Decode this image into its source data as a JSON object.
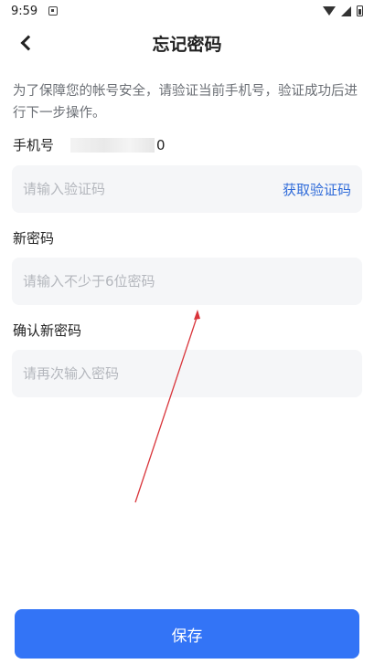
{
  "status_bar": {
    "time": "9:59",
    "notification_icon": "notification-icon",
    "wifi_icon": "wifi-icon",
    "signal_icon": "cell-signal-icon",
    "battery_icon": "battery-icon"
  },
  "header": {
    "back_icon": "chevron-left-icon",
    "title": "忘记密码"
  },
  "description": "为了保障您的帐号安全，请验证当前手机号，验证成功后进行下一步操作。",
  "phone": {
    "label": "手机号",
    "masked_tail": "0"
  },
  "verification": {
    "placeholder": "请输入验证码",
    "action_label": "获取验证码"
  },
  "new_password": {
    "label": "新密码",
    "placeholder": "请输入不少于6位密码"
  },
  "confirm_password": {
    "label": "确认新密码",
    "placeholder": "请再次输入密码"
  },
  "footer": {
    "save_label": "保存"
  },
  "colors": {
    "accent": "#3374f6",
    "link": "#2f6bd9",
    "input_bg": "#f5f6f8",
    "annotation_arrow": "#d9343a"
  }
}
